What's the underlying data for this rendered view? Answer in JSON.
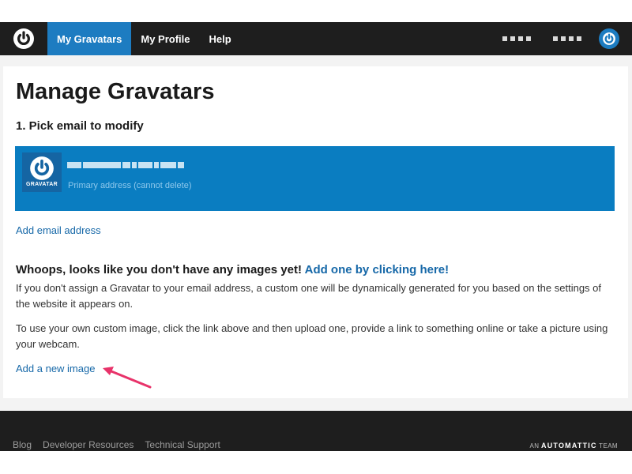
{
  "nav": {
    "items": [
      {
        "label": "My Gravatars",
        "active": true
      },
      {
        "label": "My Profile",
        "active": false
      },
      {
        "label": "Help",
        "active": false
      }
    ]
  },
  "main": {
    "title": "Manage Gravatars",
    "step_heading": "1. Pick email to modify",
    "email": {
      "avatar_brand": "GRAVATAR",
      "note": "Primary address (cannot delete)"
    },
    "add_email_label": "Add email address",
    "empty": {
      "heading": "Whoops, looks like you don't have any images yet!",
      "heading_link": "Add one by clicking here!",
      "paragraph1": "If you don't assign a Gravatar to your email address, a custom one will be dynamically generated for you based on the settings of the website it appears on.",
      "paragraph2": "To use your own custom image, click the link above and then upload one, provide a link to something online or take a picture using your webcam."
    },
    "add_image_label": "Add a new image"
  },
  "footer": {
    "links": [
      "Blog",
      "Developer Resources",
      "Technical Support"
    ],
    "brand_prefix": "AN",
    "brand_name": "AUTOMATTIC",
    "brand_suffix": "TEAM"
  },
  "colors": {
    "accent": "#1d7cc1",
    "email_box": "#0a7dc1",
    "link": "#1668a8",
    "topbar": "#1e1e1e",
    "arrow": "#e8336a"
  },
  "icons": {
    "logo": "gravatar-logo-icon",
    "avatar": "user-avatar-icon",
    "arrow": "annotation-arrow-icon"
  }
}
